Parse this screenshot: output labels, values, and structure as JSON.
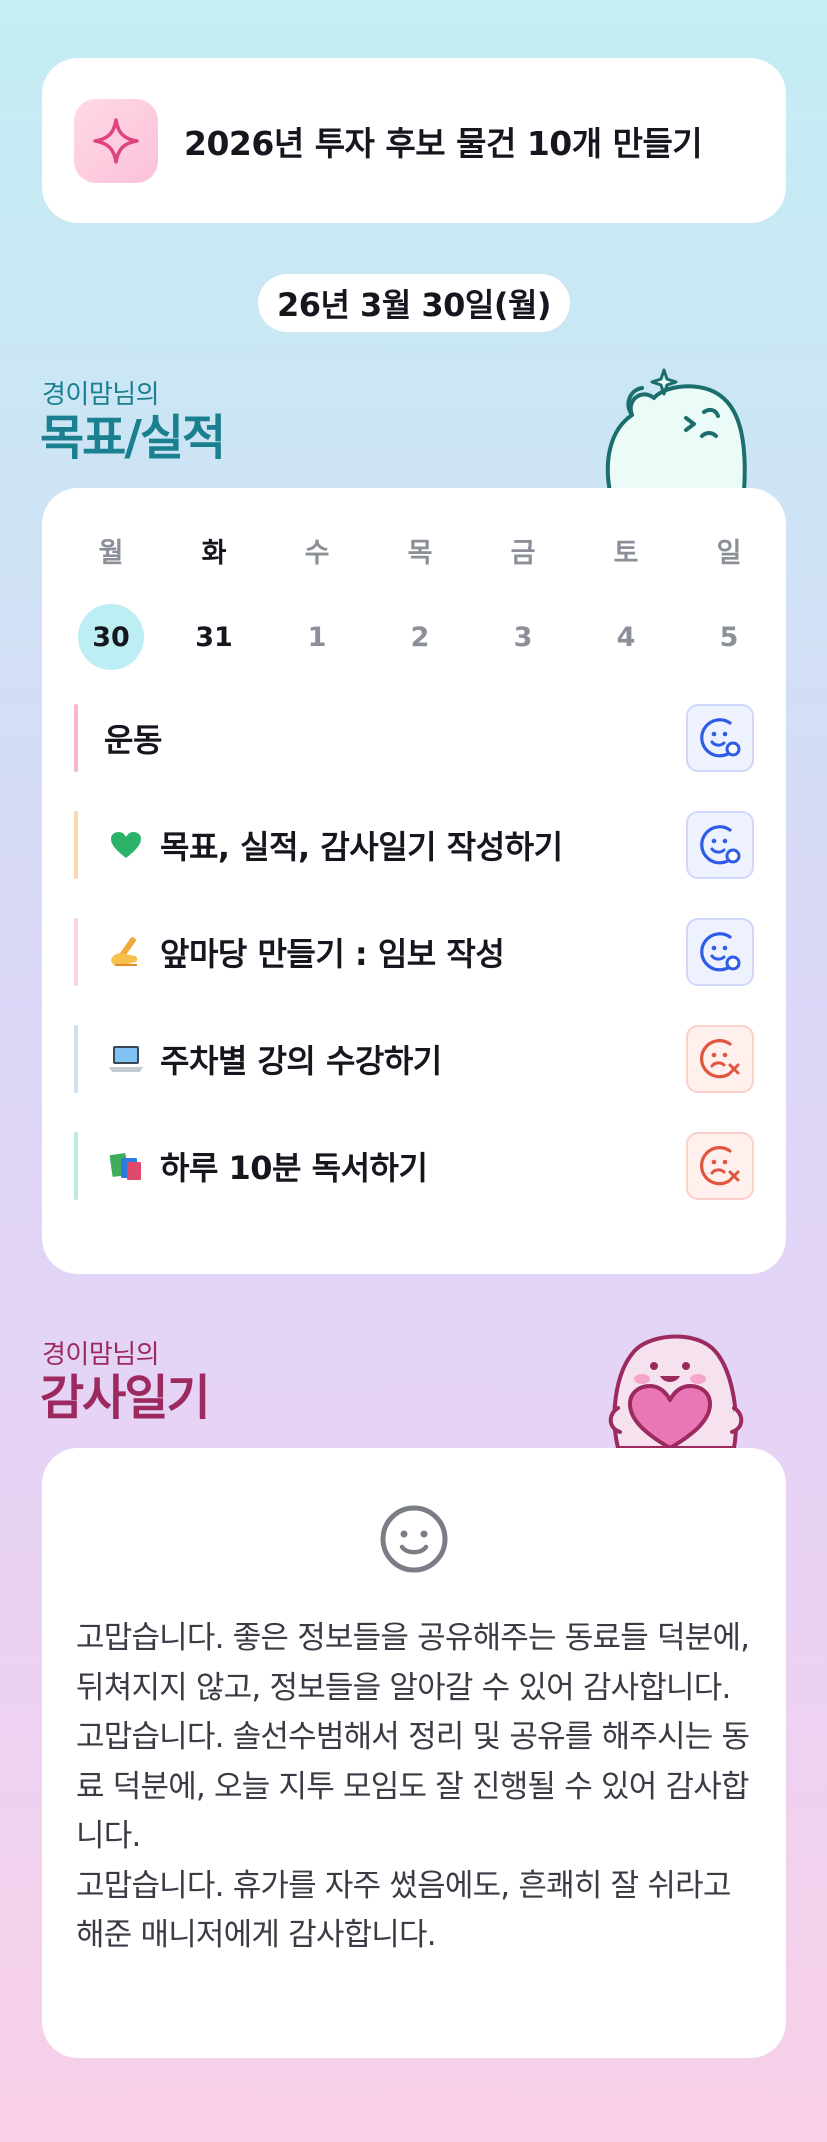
{
  "goal": {
    "icon": "sparkle-icon",
    "title": "2026년 투자 후보 물건 10개 만들기"
  },
  "date": "26년 3월 30일(월)",
  "goals_section": {
    "owner": "경이맘님의",
    "title": "목표/실적"
  },
  "week": [
    {
      "day": "월",
      "date": "30",
      "today": true
    },
    {
      "day": "화",
      "date": "31",
      "today": false
    },
    {
      "day": "수",
      "date": "1",
      "today": false
    },
    {
      "day": "목",
      "date": "2",
      "today": false
    },
    {
      "day": "금",
      "date": "3",
      "today": false
    },
    {
      "day": "토",
      "date": "4",
      "today": false
    },
    {
      "day": "일",
      "date": "5",
      "today": false
    }
  ],
  "tasks": [
    {
      "label": "운동",
      "emoji": "",
      "bar_color": "#f9b6cf",
      "status": "done"
    },
    {
      "label": "목표, 실적, 감사일기 작성하기",
      "emoji": "green-heart-icon",
      "bar_color": "#fcd7b0",
      "status": "done"
    },
    {
      "label": "앞마당 만들기 : 임보 작성",
      "emoji": "writing-hand-icon",
      "bar_color": "#fbd3dc",
      "status": "done"
    },
    {
      "label": "주차별 강의 수강하기",
      "emoji": "laptop-icon",
      "bar_color": "#cfe0f3",
      "status": "fail"
    },
    {
      "label": "하루 10분 독서하기",
      "emoji": "books-icon",
      "bar_color": "#b9ecd9",
      "status": "fail"
    }
  ],
  "diary_section": {
    "owner": "경이맘님의",
    "title": "감사일기"
  },
  "diary": {
    "icon": "smile-face-icon",
    "lines": [
      "고맙습니다. 좋은 정보들을 공유해주는 동료들 덕분에, 뒤쳐지지 않고, 정보들을 알아갈 수 있어 감사합니다.",
      "고맙습니다. 솔선수범해서 정리 및 공유를 해주시는 동료 덕분에, 오늘 지투 모임도 잘 진행될 수 있어 감사합니다.",
      "고맙습니다. 휴가를 자주 썼음에도, 흔쾌히 잘 쉬라고 해준 매니저에게 감사합니다."
    ]
  },
  "colors": {
    "teal": "#1a7f8e",
    "berry": "#9c2a5e",
    "done_icon": "#2f5ce6",
    "fail_icon": "#e0553f",
    "today_bg": "#bdeef3"
  }
}
